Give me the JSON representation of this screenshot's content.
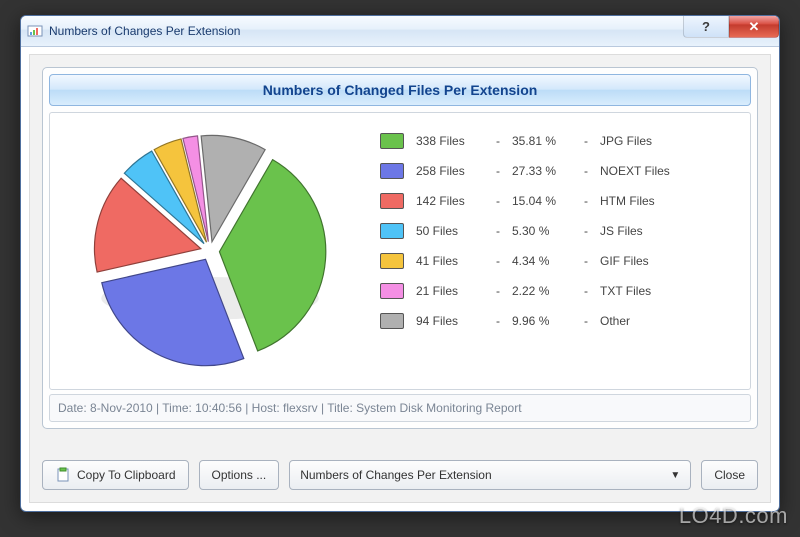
{
  "window": {
    "title": "Numbers of Changes Per Extension"
  },
  "panel": {
    "header": "Numbers of Changed Files Per Extension"
  },
  "legend": [
    {
      "files": "338 Files",
      "pct": "35.81 %",
      "label": "JPG Files",
      "color": "#6ac24c"
    },
    {
      "files": "258 Files",
      "pct": "27.33 %",
      "label": "NOEXT Files",
      "color": "#6c77e6"
    },
    {
      "files": "142 Files",
      "pct": "15.04 %",
      "label": "HTM Files",
      "color": "#ef6a63"
    },
    {
      "files": "50 Files",
      "pct": "5.30 %",
      "label": "JS Files",
      "color": "#4fc3f7"
    },
    {
      "files": "41 Files",
      "pct": "4.34 %",
      "label": "GIF Files",
      "color": "#f5c43d"
    },
    {
      "files": "21 Files",
      "pct": "2.22 %",
      "label": "TXT Files",
      "color": "#f48fe4"
    },
    {
      "files": "94 Files",
      "pct": "9.96 %",
      "label": "Other",
      "color": "#b0b0b0"
    }
  ],
  "footer": "Date: 8-Nov-2010 | Time: 10:40:56 | Host: flexsrv | Title: System Disk Monitoring Report",
  "toolbar": {
    "copy": "Copy To Clipboard",
    "options": "Options ...",
    "select_value": "Numbers of Changes Per Extension",
    "close": "Close"
  },
  "watermark": "LO4D.com",
  "chart_data": {
    "type": "pie",
    "title": "Numbers of Changed Files Per Extension",
    "series": [
      {
        "name": "JPG Files",
        "value": 338,
        "pct": 35.81,
        "color": "#6ac24c"
      },
      {
        "name": "NOEXT Files",
        "value": 258,
        "pct": 27.33,
        "color": "#6c77e6"
      },
      {
        "name": "HTM Files",
        "value": 142,
        "pct": 15.04,
        "color": "#ef6a63"
      },
      {
        "name": "JS Files",
        "value": 50,
        "pct": 5.3,
        "color": "#4fc3f7"
      },
      {
        "name": "GIF Files",
        "value": 41,
        "pct": 4.34,
        "color": "#f5c43d"
      },
      {
        "name": "TXT Files",
        "value": 21,
        "pct": 2.22,
        "color": "#f48fe4"
      },
      {
        "name": "Other",
        "value": 94,
        "pct": 9.96,
        "color": "#b0b0b0"
      }
    ]
  }
}
